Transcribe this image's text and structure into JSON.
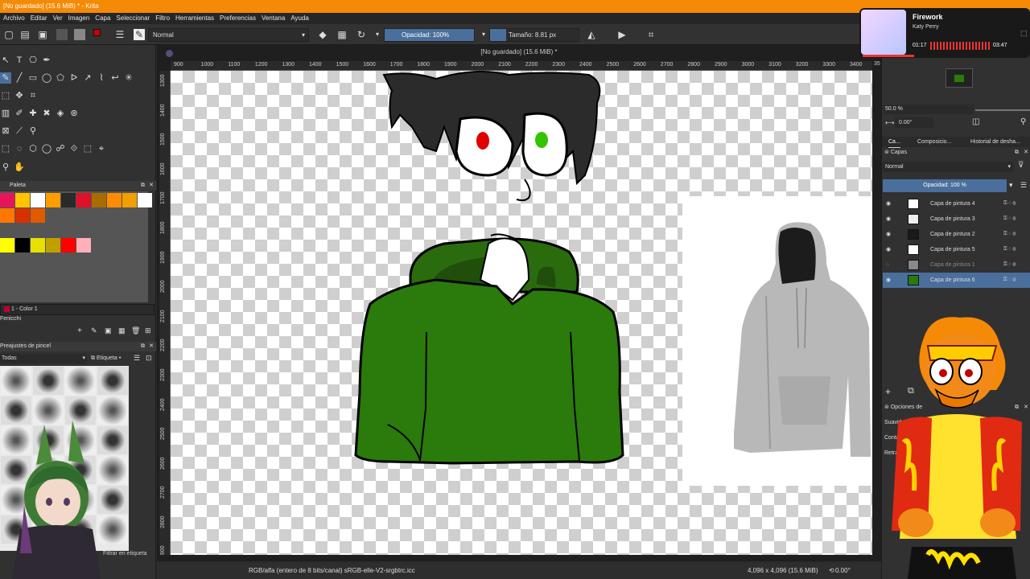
{
  "window": {
    "title": "[No guardado]  (15.6 MiB) * - Krita"
  },
  "menu": [
    "Archivo",
    "Editar",
    "Ver",
    "Imagen",
    "Capa",
    "Seleccionar",
    "Filtro",
    "Herramientas",
    "Preferencias",
    "Ventana",
    "Ayuda"
  ],
  "toolbar": {
    "blend_mode": "Normal",
    "opacity": "Opacidad: 100%",
    "size": "Tamaño: 8.81 px"
  },
  "document": {
    "title": "[No guardado]  (15.6 MiB) *",
    "ruler_top": [
      "900",
      "1000",
      "1100",
      "1200",
      "1300",
      "1400",
      "1500",
      "1600",
      "1700",
      "1800",
      "1900",
      "2000",
      "2100",
      "2200",
      "2300",
      "2400",
      "2500",
      "2600",
      "2700",
      "2800",
      "2900",
      "3000",
      "3100",
      "3200",
      "3300",
      "3400",
      "35"
    ],
    "ruler_left": [
      "1300",
      "1400",
      "1500",
      "1600",
      "1700",
      "1800",
      "1900",
      "2000",
      "2100",
      "2200",
      "2300",
      "2400",
      "2500",
      "2600",
      "2700",
      "2800",
      "2900"
    ]
  },
  "status": {
    "color_profile": "RGB/alfa (entero de 8 bits/canal)  sRGB-elle-V2-srgbtrc.icc",
    "dimensions": "4,096 x 4,096 (15.6 MiB)",
    "rotation": "0.00°"
  },
  "left_panel": {
    "palette_title": "Paleta",
    "palette_colors": [
      "#e8145a",
      "#ffc400",
      "#ffffff",
      "#ff9d00",
      "#2a2a2a",
      "#e0102a",
      "#a86c00",
      "#ff8c00",
      "#f0a000",
      "#ffffff",
      "#ff7700",
      "#d83000",
      "#e05a00",
      "#ffff00",
      "#000000",
      "#e8e000",
      "#c0a000",
      "#ff0000",
      "#ffb0b8"
    ],
    "color_set": "1 - Color 1",
    "fenicchi": "Fenicchi",
    "brush_presets_title": "Preajustes de pincel",
    "brush_filter": "Todas",
    "tag_label": "Etiqueta",
    "filter_tag": "Filtrar en etiqueta"
  },
  "right_panel": {
    "zoom": "50.0 %",
    "rotation": "0.00°",
    "tabs": [
      "Ca...",
      "Composicio...",
      "Historial de desha..."
    ],
    "layers_title": "Capas",
    "layer_blend": "Normal",
    "layer_opacity": "Opacidad:  100 %",
    "layers": [
      {
        "name": "Capa de pintura 4",
        "visible": true,
        "selected": false
      },
      {
        "name": "Capa de pintura 3",
        "visible": true,
        "selected": false
      },
      {
        "name": "Capa de pintura 2",
        "visible": true,
        "selected": false
      },
      {
        "name": "Capa de pintura 5",
        "visible": true,
        "selected": false
      },
      {
        "name": "Capa de pintura 1",
        "visible": false,
        "selected": false
      },
      {
        "name": "Capa de pintura 6",
        "visible": true,
        "selected": true
      }
    ],
    "tool_options_title": "Opciones de",
    "tool_options": [
      "Suavidad",
      "Contad",
      "Retra"
    ]
  },
  "media": {
    "song": "Firework",
    "artist": "Katy Perry",
    "elapsed": "01:17",
    "total": "03:47"
  },
  "colors": {
    "accent": "#f58a07",
    "selection_blue": "#4a6f9c",
    "hoodie_green": "#2a7a0c",
    "hair": "#2b2b2b"
  }
}
